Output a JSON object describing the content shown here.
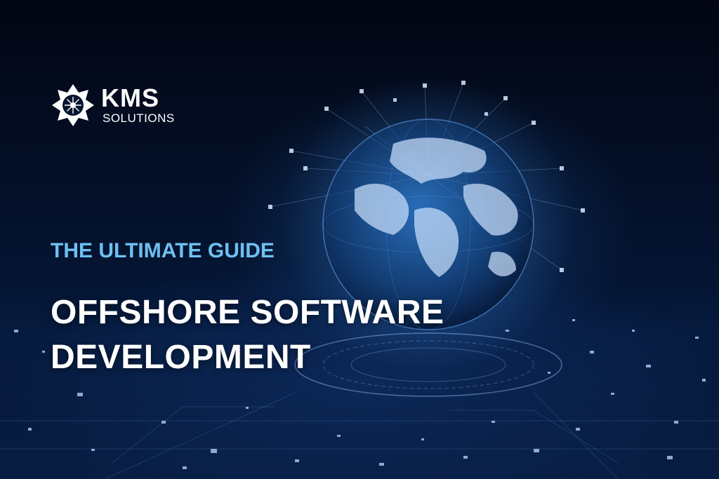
{
  "brand": {
    "wordmark": "KMS",
    "sub": "SOLUTIONS",
    "icon": "kms-logo-icon"
  },
  "hero": {
    "subtitle": "THE ULTIMATE GUIDE",
    "headline": "OFFSHORE SOFTWARE DEVELOPMENT",
    "illustration": "digital-globe-network"
  },
  "colors": {
    "background": "#03091a",
    "subtitle": "#6ec0f0",
    "headline": "#ffffff",
    "globe": "#3a8fe0"
  }
}
